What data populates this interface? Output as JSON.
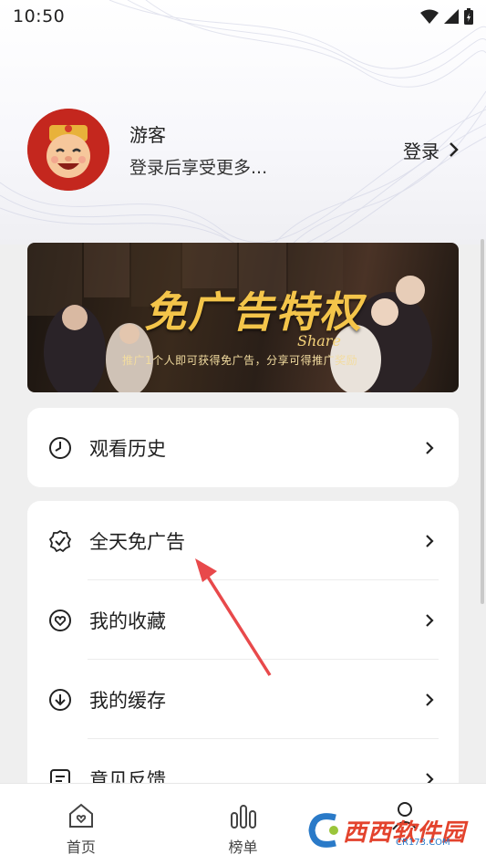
{
  "status_bar": {
    "time": "10:50"
  },
  "profile": {
    "name": "游客",
    "subtitle": "登录后享受更多...",
    "login_label": "登录"
  },
  "banner": {
    "title": "免广告特权",
    "share": "Share",
    "subtitle": "推广1个人即可获得免广告，分享可得推广奖励"
  },
  "menu_history": {
    "items": [
      {
        "label": "观看历史",
        "icon": "clock-icon"
      }
    ]
  },
  "menu_main": {
    "items": [
      {
        "label": "全天免广告",
        "icon": "badge-check-icon"
      },
      {
        "label": "我的收藏",
        "icon": "heart-icon"
      },
      {
        "label": "我的缓存",
        "icon": "download-icon"
      },
      {
        "label": "意见反馈",
        "icon": "feedback-icon"
      }
    ]
  },
  "tabbar": {
    "items": [
      {
        "label": "首页",
        "icon": "home-icon"
      },
      {
        "label": "榜单",
        "icon": "chart-icon"
      },
      {
        "label": "",
        "icon": "profile-icon"
      }
    ]
  },
  "watermark": {
    "text": "西西软件园",
    "sub": "CR173.COM"
  },
  "colors": {
    "accent_arrow": "#e8494b",
    "banner_gold": "#f4c54a",
    "background": "#efefef"
  }
}
